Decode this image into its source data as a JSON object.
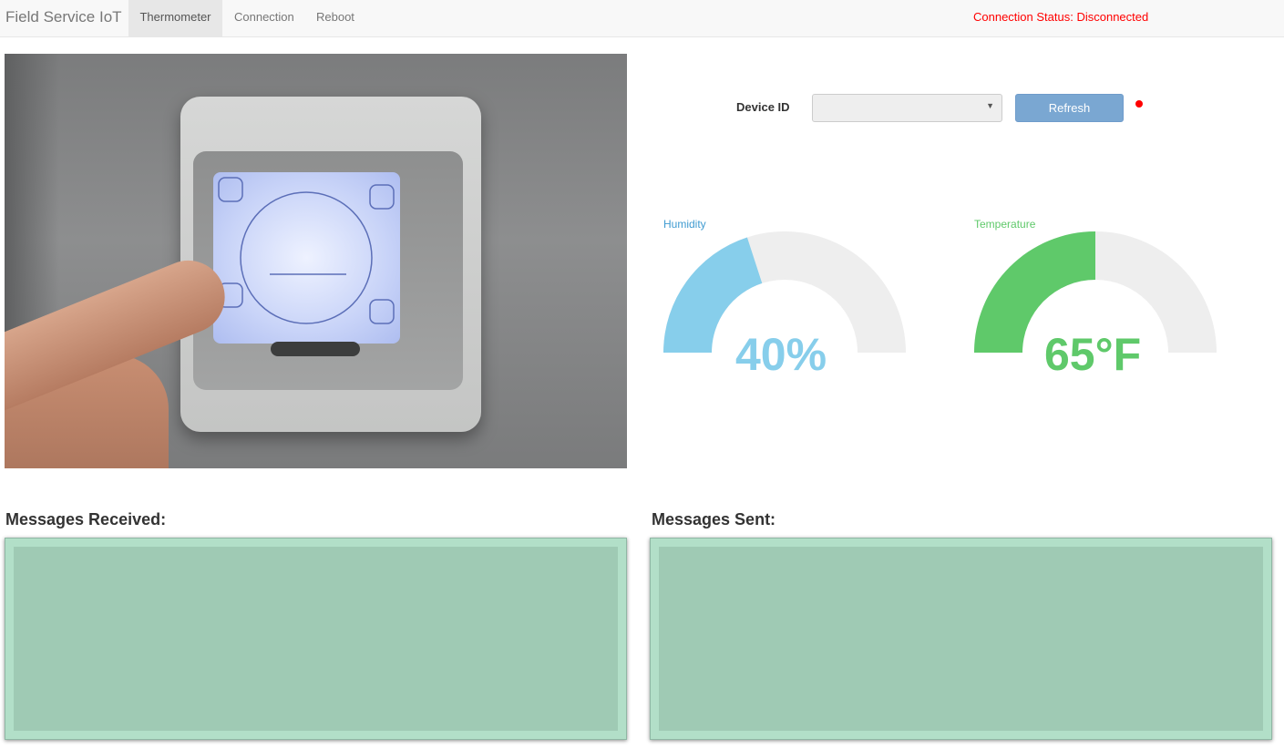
{
  "navbar": {
    "brand": "Field Service IoT",
    "tabs": [
      {
        "label": "Thermometer",
        "active": true
      },
      {
        "label": "Connection",
        "active": false
      },
      {
        "label": "Reboot",
        "active": false
      }
    ],
    "connection_status": "Connection Status: Disconnected"
  },
  "device": {
    "label": "Device ID",
    "selected": "",
    "refresh_label": "Refresh",
    "status_dot_color": "#ff0000"
  },
  "gauges": {
    "humidity": {
      "title": "Humidity",
      "value_text": "40%",
      "fraction": 0.4,
      "color": "#87ceeb"
    },
    "temperature": {
      "title": "Temperature",
      "value_text": "65°F",
      "fraction": 0.5,
      "color": "#5fc96a"
    }
  },
  "messages": {
    "received_title": "Messages Received:",
    "sent_title": "Messages Sent:"
  }
}
